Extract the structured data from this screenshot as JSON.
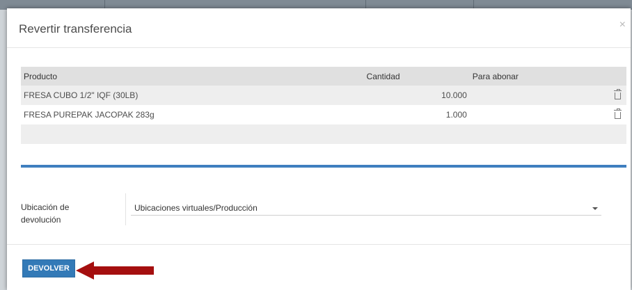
{
  "modal": {
    "title": "Revertir transferencia",
    "close_label": "×"
  },
  "table": {
    "headers": [
      "Producto",
      "Cantidad",
      "Para abonar"
    ],
    "rows": [
      {
        "producto": "FRESA CUBO 1/2\" IQF (30LB)",
        "cantidad": "10.000",
        "para_abonar": ""
      },
      {
        "producto": "FRESA PUREPAK JACOPAK 283g",
        "cantidad": "1.000",
        "para_abonar": ""
      }
    ]
  },
  "location": {
    "label_line1": "Ubicación de",
    "label_line2": "devolución",
    "value": "Ubicaciones virtuales/Producción"
  },
  "footer": {
    "devolver_label": "DEVOLVER"
  },
  "colors": {
    "accent_bar": "#3f7fbf",
    "primary_button": "#337ab7",
    "annotation_arrow": "#a50f0f"
  },
  "icons": {
    "delete": "trash-icon",
    "dropdown": "chevron-down-icon",
    "close": "close-icon",
    "annotation": "arrow-left-icon"
  }
}
